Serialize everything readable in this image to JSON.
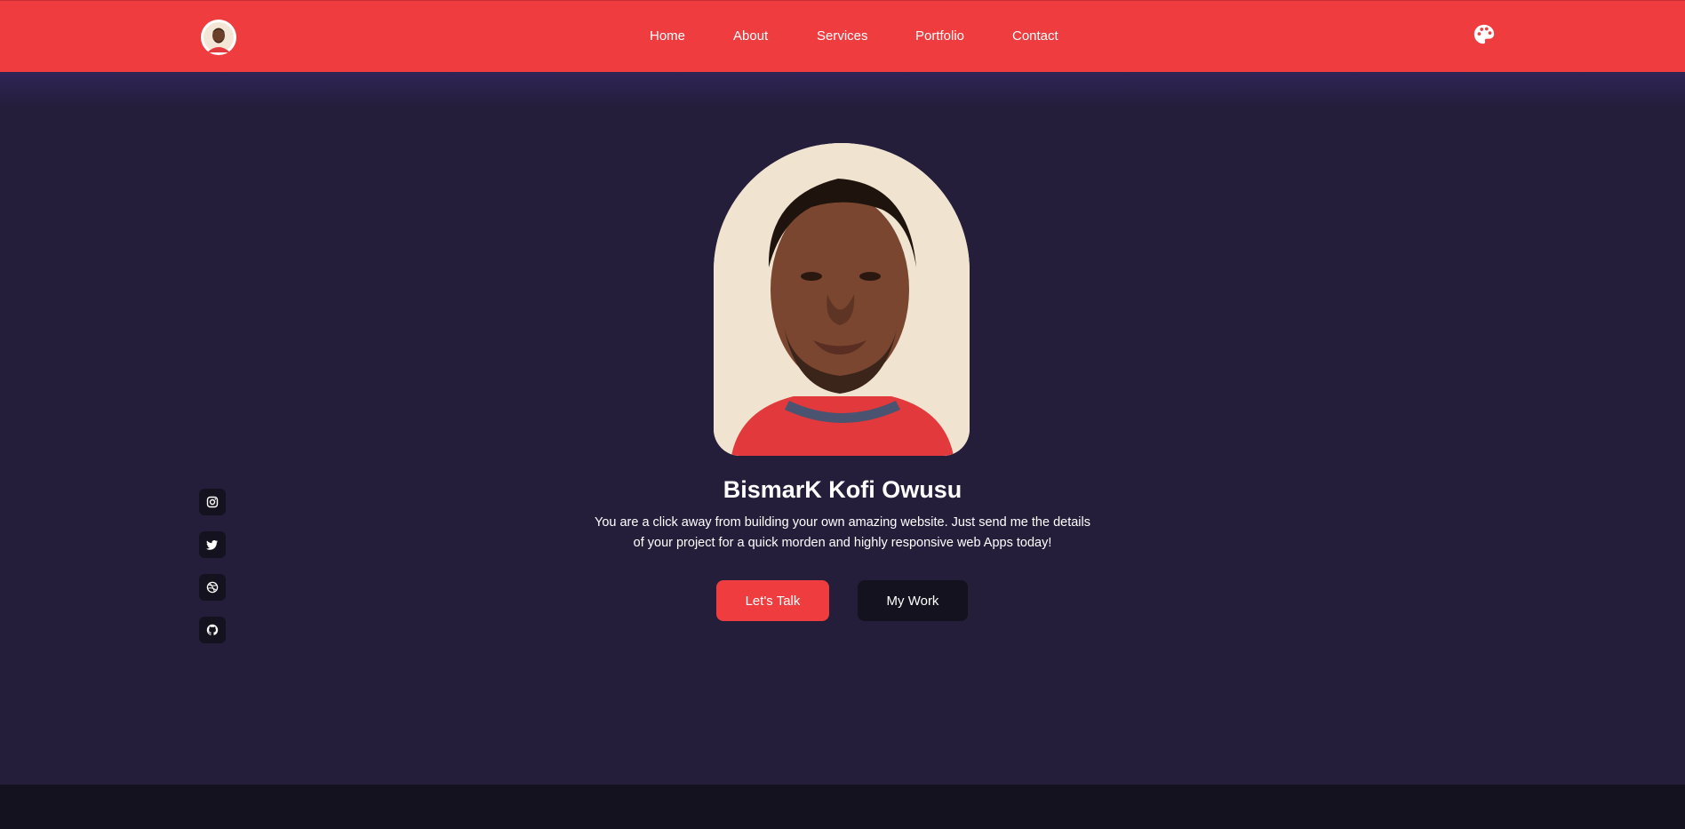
{
  "nav": {
    "links": [
      {
        "label": "Home"
      },
      {
        "label": "About"
      },
      {
        "label": "Services"
      },
      {
        "label": "Portfolio"
      },
      {
        "label": "Contact"
      }
    ],
    "theme_icon": "palette-icon",
    "avatar_icon": "profile-avatar"
  },
  "hero": {
    "name": "BismarK Kofi Owusu",
    "tagline_line1": "You are a click away from building your own amazing website. Just send me the details",
    "tagline_line2": "of your project for a quick morden and highly responsive web Apps today!",
    "primary_button": "Let's Talk",
    "secondary_button": "My Work"
  },
  "social": [
    {
      "icon": "instagram-icon"
    },
    {
      "icon": "twitter-icon"
    },
    {
      "icon": "dribbble-icon"
    },
    {
      "icon": "github-icon"
    }
  ],
  "colors": {
    "accent": "#ef3c3f",
    "background": "#241e3b",
    "dark": "#15121f"
  }
}
